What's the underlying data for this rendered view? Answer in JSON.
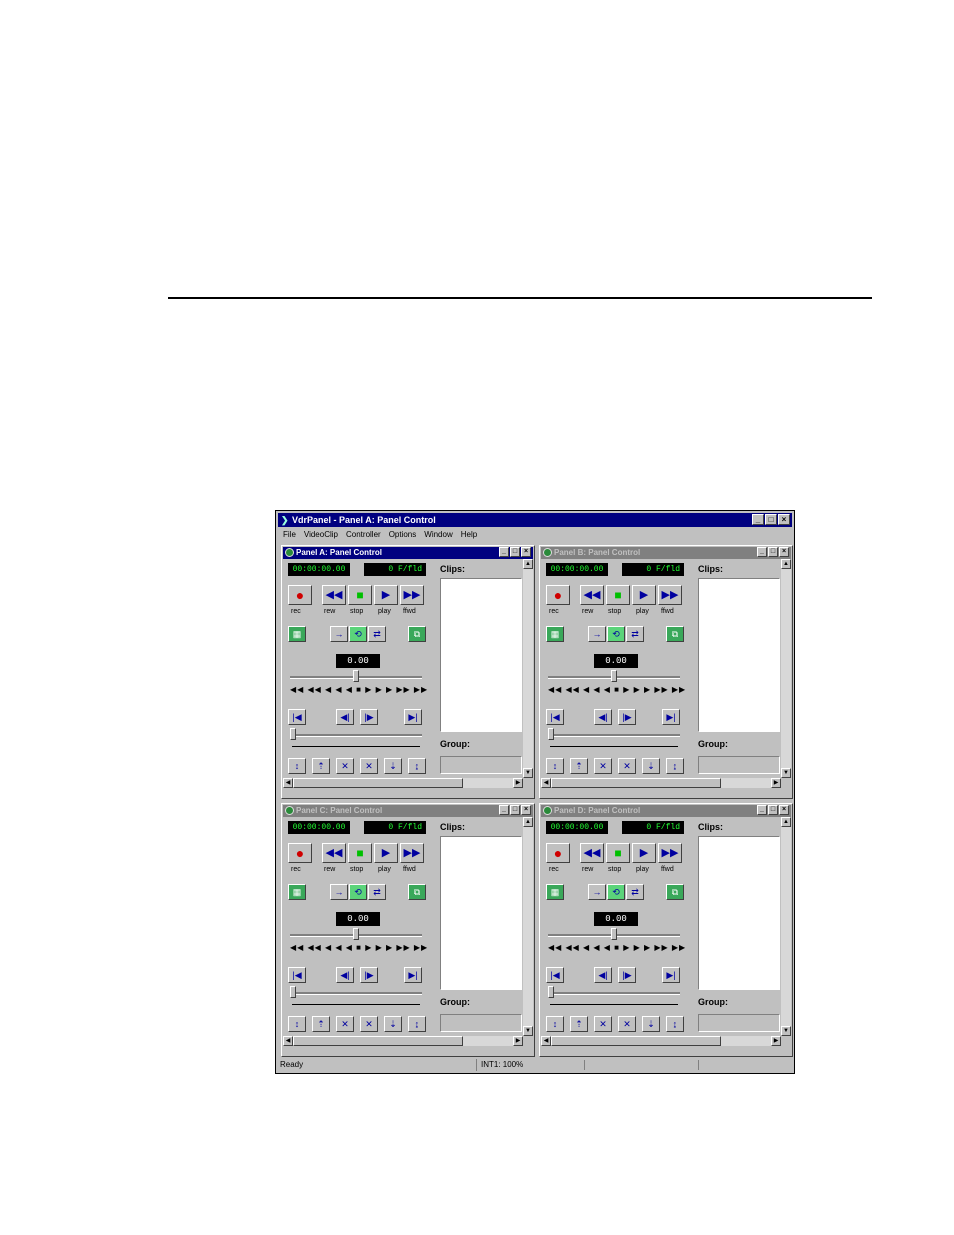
{
  "app": {
    "title": "VdrPanel - Panel A: Panel Control",
    "menu": [
      "File",
      "VideoClip",
      "Controller",
      "Options",
      "Window",
      "Help"
    ],
    "window_controls": [
      "_",
      "□",
      "×"
    ],
    "status": {
      "left": "Ready",
      "middle": "INT1: 100%"
    }
  },
  "panels": [
    {
      "title": "Panel A: Panel Control",
      "active": true
    },
    {
      "title": "Panel B: Panel Control",
      "active": false
    },
    {
      "title": "Panel C: Panel Control",
      "active": false
    },
    {
      "title": "Panel D: Panel Control",
      "active": false
    }
  ],
  "panel": {
    "timecode": "00:00:00.00",
    "fields": "0 F/fld",
    "clips_label": "Clips:",
    "group_label": "Group:",
    "speed": "0.00",
    "transport": [
      {
        "icon": "record-icon",
        "glyph": "●",
        "caption": "rec"
      },
      {
        "icon": "rewind-icon",
        "glyph": "◀◀",
        "caption": "rew"
      },
      {
        "icon": "stop-icon",
        "glyph": "■",
        "caption": "stop"
      },
      {
        "icon": "play-icon",
        "glyph": "▶",
        "caption": "play"
      },
      {
        "icon": "fast-forward-icon",
        "glyph": "▶▶",
        "caption": "ffwd"
      }
    ],
    "jog_ticks": "◀◀ ◀◀ ◀ ◀ ◀ ■ ▶ ▶ ▶ ▶▶ ▶▶",
    "glyphs": {
      "fields": "▦",
      "play_once": "→",
      "loop": "⟲",
      "bounce": "⇄",
      "sync": "⧉",
      "goto_start": "|◀",
      "step_back": "◀|",
      "step_fwd": "|▶",
      "goto_end": "▶|",
      "mark_a": "↕",
      "mark_b": "⇡",
      "mark_c": "✕",
      "mark_d": "✕",
      "mark_e": "⇣",
      "mark_f": "↨",
      "scroll_up": "▲",
      "scroll_down": "▼",
      "scroll_left": "◀",
      "scroll_right": "▶"
    }
  }
}
